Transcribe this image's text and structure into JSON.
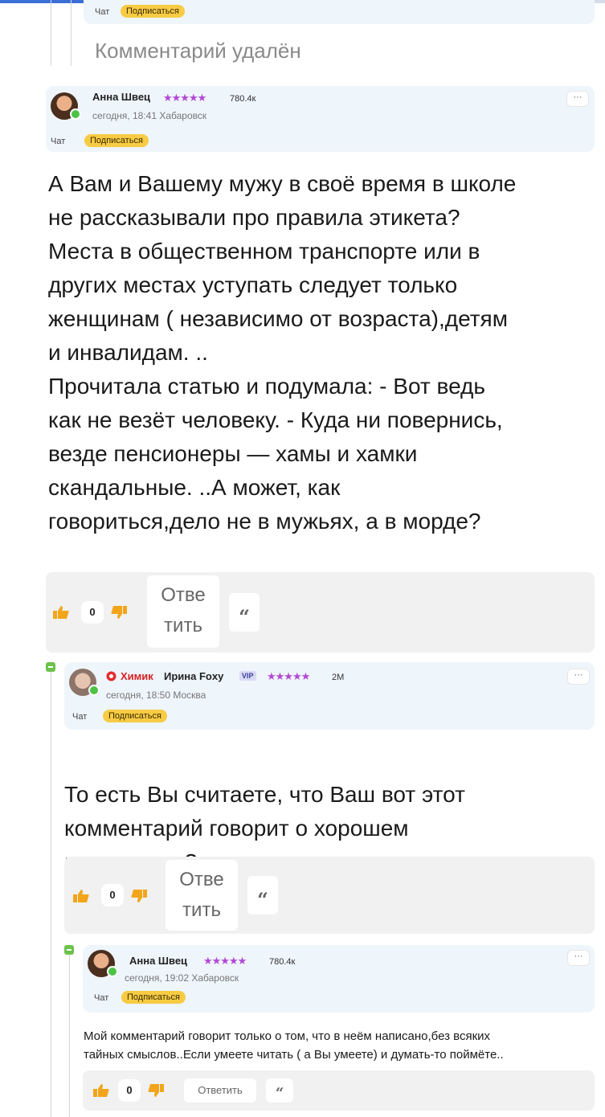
{
  "top_partial": {
    "chat": "Чат",
    "subscribe": "Подписаться"
  },
  "deleted_comment": "Комментарий удалён",
  "comment1": {
    "author": "Анна Швец",
    "stars": "★★★★★",
    "rating": "780.4к",
    "meta": "сегодня, 18:41  Хабаровск",
    "chat": "Чат",
    "subscribe": "Подписаться",
    "menu": "···",
    "text": "А Вам и Вашему мужу в своё время в школе\nне рассказывали про правила этикета?\nМеста в общественном транспорте или в\nдругих местах уступать следует только\nженщинам ( независимо от возраста),детям\nи инвалидам. ..\nПрочитала статью и подумала: - Вот ведь\nкак не везёт человеку. - Куда ни повернись,\nвезде пенсионеры — хамы и хамки\nскандальные. ..А может, как\nговориться,дело не в мужьях, а в морде?",
    "votes": "0",
    "reply": "Ответить",
    "reply_line1": "Отве",
    "reply_line2": "тить",
    "quote": "“"
  },
  "comment2": {
    "badge": "Химик",
    "author": "Ирина Foxy",
    "vip": "VIP",
    "stars": "★★★★★",
    "rating": "2M",
    "meta": "сегодня, 18:50  Москва",
    "chat": "Чат",
    "subscribe": "Подписаться",
    "menu": "···",
    "text": "То есть Вы считаете, что Ваш вот этот\nкомментарий говорит о хорошем\nвоспитании?",
    "emoji": "😅",
    "votes": "0",
    "reply_line1": "Отве",
    "reply_line2": "тить",
    "quote": "“"
  },
  "comment3": {
    "author": "Анна Швец",
    "stars": "★★★★★",
    "rating": "780.4к",
    "meta": "сегодня, 19:02  Хабаровск",
    "chat": "Чат",
    "subscribe": "Подписаться",
    "menu": "···",
    "text": "Мой комментарий говорит только о том, что в неём написано,без всяких\nтайных смыслов..Если умеете читать ( а Вы умеете) и думать-то поймёте..",
    "votes": "0",
    "reply": "Ответить",
    "quote": "“"
  },
  "colors": {
    "accent_yellow": "#f7cb44",
    "header_bg": "#eef5fb",
    "online_green": "#4cc247",
    "star_purple": "#b347d6"
  },
  "icons": [
    "thumbs-up-icon",
    "thumbs-down-icon",
    "quote-icon",
    "more-dots-icon",
    "collapse-icon",
    "online-dot-icon"
  ]
}
